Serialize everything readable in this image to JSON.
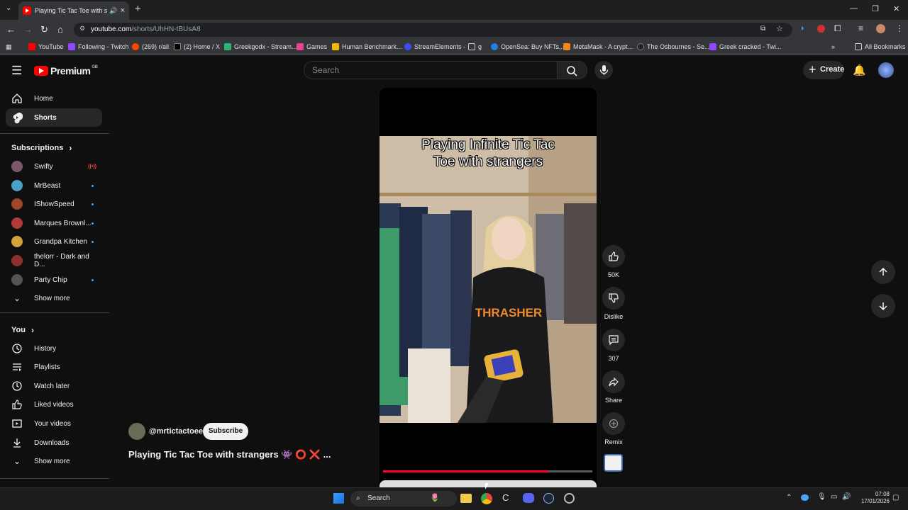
{
  "browser": {
    "tab_title": "Playing Tic Tac Toe with stra",
    "url_host": "youtube.com",
    "url_path": "/shorts/UhHN-tBUsA8",
    "bookmarks": [
      "YouTube",
      "Following - Twitch",
      "(269) r/all",
      "(2) Home / X",
      "Greekgodx - Stream...",
      "Games",
      "Human Benchmark...",
      "StreamElements -",
      "g",
      "OpenSea: Buy NFTs,...",
      "MetaMask - A crypt...",
      "The Osbournes - Se...",
      "Greek cracked - Twi..."
    ],
    "all_bookmarks": "All Bookmarks"
  },
  "header": {
    "logo_text": "Premium",
    "logo_region": "GB",
    "search_placeholder": "Search",
    "create_label": "Create"
  },
  "sidebar": {
    "main": [
      {
        "label": "Home",
        "icon": "home-icon"
      },
      {
        "label": "Shorts",
        "icon": "shorts-icon"
      }
    ],
    "subscriptions_title": "Subscriptions",
    "subscriptions": [
      {
        "label": "Swifty",
        "color": "#7a5a6a",
        "live": true
      },
      {
        "label": "MrBeast",
        "color": "#4aa3c7"
      },
      {
        "label": "IShowSpeed",
        "color": "#a1462f"
      },
      {
        "label": "Marques Brownl...",
        "color": "#b23b3b"
      },
      {
        "label": "Grandpa Kitchen",
        "color": "#d4a13a"
      },
      {
        "label": "thelorr - Dark and D...",
        "color": "#8f2f2f"
      },
      {
        "label": "Party Chip",
        "color": "#555555"
      }
    ],
    "show_more": "Show more",
    "you_title": "You",
    "you_items": [
      {
        "label": "History",
        "icon": "history-icon"
      },
      {
        "label": "Playlists",
        "icon": "playlists-icon"
      },
      {
        "label": "Watch later",
        "icon": "watch-later-icon"
      },
      {
        "label": "Liked videos",
        "icon": "thumbs-up-icon"
      },
      {
        "label": "Your videos",
        "icon": "your-videos-icon"
      },
      {
        "label": "Downloads",
        "icon": "download-icon"
      }
    ],
    "show_more_2": "Show more"
  },
  "short": {
    "caption_line1": "Playing Infinite Tic Tac",
    "caption_line2": "Toe with strangers",
    "channel": "@mrtictactoee",
    "subscribe": "Subscribe",
    "title": "Playing Tic Tac Toe with strangers 👾 ⭕ ❌ ...",
    "progress": 0.79
  },
  "actions": {
    "likes": "50K",
    "dislike": "Dislike",
    "comments": "307",
    "share": "Share",
    "remix": "Remix"
  },
  "taskbar": {
    "search": "Search",
    "time": "07:08",
    "date": "17/01/2026"
  },
  "colors": {
    "brand_red": "#ff0000",
    "progress_red": "#ff0033"
  }
}
